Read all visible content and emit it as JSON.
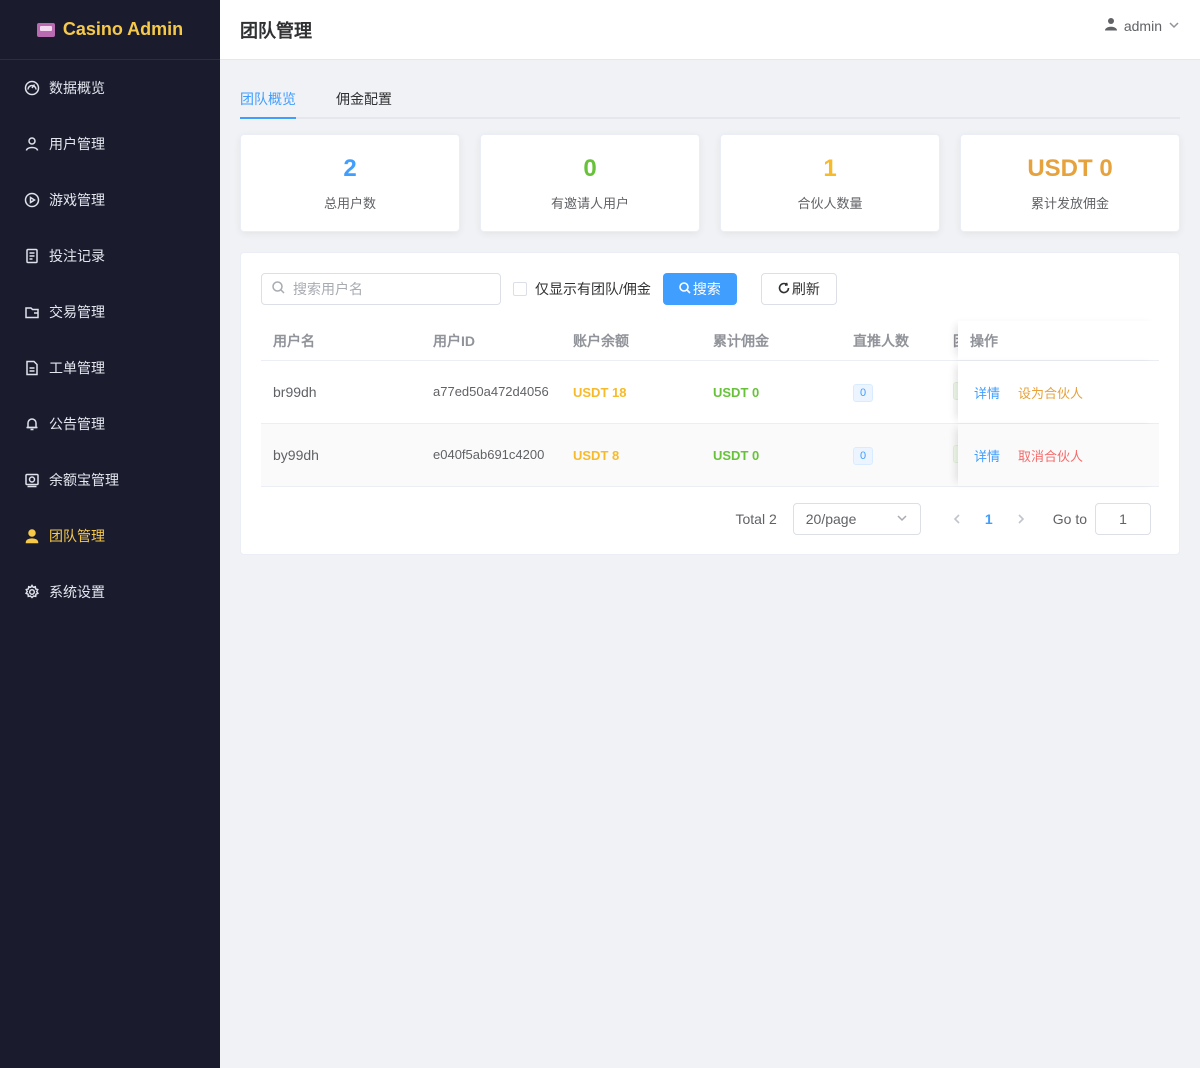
{
  "brand": {
    "title": "Casino Admin"
  },
  "sidebar": {
    "items": [
      {
        "label": "数据概览",
        "icon": "dashboard-icon",
        "active": false
      },
      {
        "label": "用户管理",
        "icon": "user-icon",
        "active": false
      },
      {
        "label": "游戏管理",
        "icon": "play-icon",
        "active": false
      },
      {
        "label": "投注记录",
        "icon": "document-icon",
        "active": false
      },
      {
        "label": "交易管理",
        "icon": "wallet-icon",
        "active": false
      },
      {
        "label": "工单管理",
        "icon": "ticket-icon",
        "active": false
      },
      {
        "label": "公告管理",
        "icon": "bell-icon",
        "active": false
      },
      {
        "label": "余额宝管理",
        "icon": "safe-icon",
        "active": false
      },
      {
        "label": "团队管理",
        "icon": "team-icon",
        "active": true
      },
      {
        "label": "系统设置",
        "icon": "gear-icon",
        "active": false
      }
    ]
  },
  "header": {
    "title": "团队管理",
    "username": "admin"
  },
  "tabs": [
    {
      "label": "团队概览",
      "active": true
    },
    {
      "label": "佣金配置",
      "active": false
    }
  ],
  "stats": [
    {
      "value": "2",
      "label": "总用户数",
      "color": "#409eff"
    },
    {
      "value": "0",
      "label": "有邀请人用户",
      "color": "#67c23a"
    },
    {
      "value": "1",
      "label": "合伙人数量",
      "color": "#f7ba2a"
    },
    {
      "value": "USDT 0",
      "label": "累计发放佣金",
      "color": "#e6a23c"
    }
  ],
  "toolbar": {
    "search_placeholder": "搜索用户名",
    "checkbox_label": "仅显示有团队/佣金",
    "search_label": "搜索",
    "refresh_label": "刷新"
  },
  "table": {
    "columns": [
      "用户名",
      "用户ID",
      "账户余额",
      "累计佣金",
      "直推人数",
      "团",
      "操作"
    ],
    "rows": [
      {
        "username": "br99dh",
        "user_id": "a77ed50a472d4056",
        "balance": "USDT 18",
        "commission": "USDT 0",
        "direct": "0",
        "action_detail": "详情",
        "action_partner": "设为合伙人"
      },
      {
        "username": "by99dh",
        "user_id": "e040f5ab691c4200",
        "balance": "USDT 8",
        "commission": "USDT 0",
        "direct": "0",
        "action_detail": "详情",
        "action_partner": "取消合伙人"
      }
    ]
  },
  "pagination": {
    "total": "Total 2",
    "page_size": "20/page",
    "current_page": "1",
    "goto_label": "Go to",
    "goto_value": "1"
  }
}
